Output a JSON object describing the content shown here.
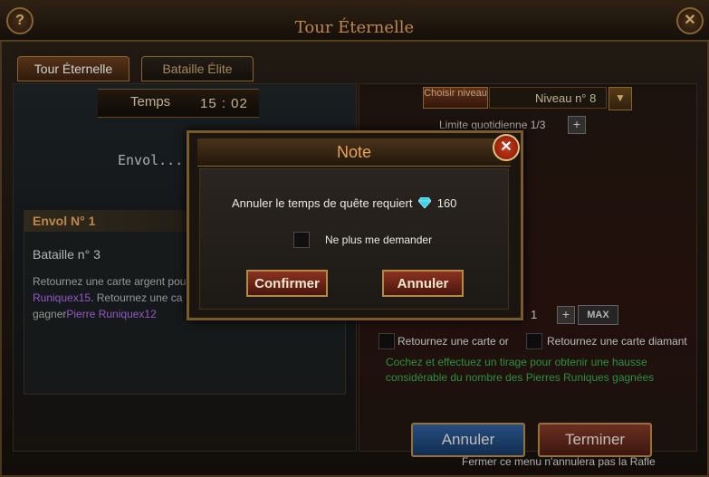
{
  "window": {
    "title": "Tour Éternelle",
    "help_label": "?",
    "close_label": "✕"
  },
  "tabs": [
    {
      "label": "Tour Éternelle",
      "active": true
    },
    {
      "label": "Bataille Élite",
      "active": false
    }
  ],
  "left": {
    "time_label": "Temps",
    "time_value": "15 : 02",
    "envol_text": "Envol...",
    "quest": {
      "header": "Envol N° 1",
      "title": "Bataille n° 3",
      "desc_part1": "Retournez une carte argent pou",
      "link1": "Runiquex15",
      "desc_part2": ". Retournez une ca",
      "desc_part3": "gagner",
      "link2": "Pierre Runiquex12"
    }
  },
  "right": {
    "level_button": "Choisir niveau",
    "level_value": "Niveau n° 8",
    "daily_limit": "Limite quotidienne  1/3",
    "quantity": "1",
    "max_label": "MAX",
    "option_gold": "Retournez une carte or",
    "option_diamond": "Retournez une carte diamant",
    "info": "Cochez et effectuez un tirage pour obtenir une hausse considérable du nombre des Pierres Runiques gagnées",
    "cancel_label": "Annuler",
    "finish_label": "Terminer",
    "footer": "Fermer ce menu n'annulera pas la Rafle"
  },
  "modal": {
    "title": "Note",
    "message": "Annuler le temps de quête requiert",
    "cost": "160",
    "checkbox_label": "Ne plus me demander",
    "confirm_label": "Confirmer",
    "cancel_label": "Annuler"
  },
  "colors": {
    "accent": "#e8a45a",
    "link_purple": "#b56cf2",
    "info_green": "#39b04a"
  }
}
